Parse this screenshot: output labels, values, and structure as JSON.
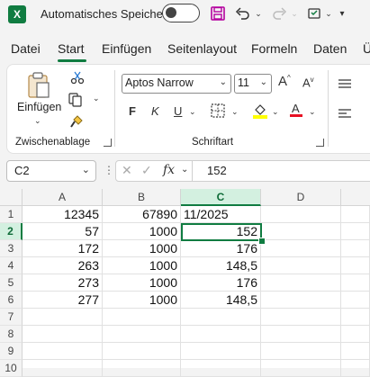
{
  "titlebar": {
    "app_icon_letter": "X",
    "autosave_label": "Automatisches Speichern",
    "autosave_on": false
  },
  "tabs": [
    "Datei",
    "Start",
    "Einfügen",
    "Seitenlayout",
    "Formeln",
    "Daten",
    "Ü"
  ],
  "active_tab": "Start",
  "ribbon": {
    "paste_label": "Einfügen",
    "clipboard_group": "Zwischenablage",
    "font_group": "Schriftart",
    "font_name": "Aptos Narrow",
    "font_size": "11",
    "bold": "F",
    "italic": "K",
    "underline": "U"
  },
  "formula_bar": {
    "name_box": "C2",
    "formula": "152",
    "fx": "fx"
  },
  "grid": {
    "columns": [
      "A",
      "B",
      "C",
      "D"
    ],
    "selected_column": "C",
    "selected_row": 2,
    "rows": [
      {
        "row": "1",
        "A": "12345",
        "B": "67890",
        "C": "11/2025"
      },
      {
        "row": "2",
        "A": "57",
        "B": "1000",
        "C": "152"
      },
      {
        "row": "3",
        "A": "172",
        "B": "1000",
        "C": "176"
      },
      {
        "row": "4",
        "A": "263",
        "B": "1000",
        "C": "148,5"
      },
      {
        "row": "5",
        "A": "273",
        "B": "1000",
        "C": "176"
      },
      {
        "row": "6",
        "A": "277",
        "B": "1000",
        "C": "148,5"
      },
      {
        "row": "7",
        "A": "",
        "B": "",
        "C": ""
      },
      {
        "row": "8",
        "A": "",
        "B": "",
        "C": ""
      },
      {
        "row": "9",
        "A": "",
        "B": "",
        "C": ""
      },
      {
        "row": "10",
        "A": "",
        "B": "",
        "C": ""
      }
    ]
  },
  "colors": {
    "accent": "#107c41",
    "save_icon": "#b4009e",
    "highlight": "#ffff00",
    "font_color": "#e81123"
  }
}
